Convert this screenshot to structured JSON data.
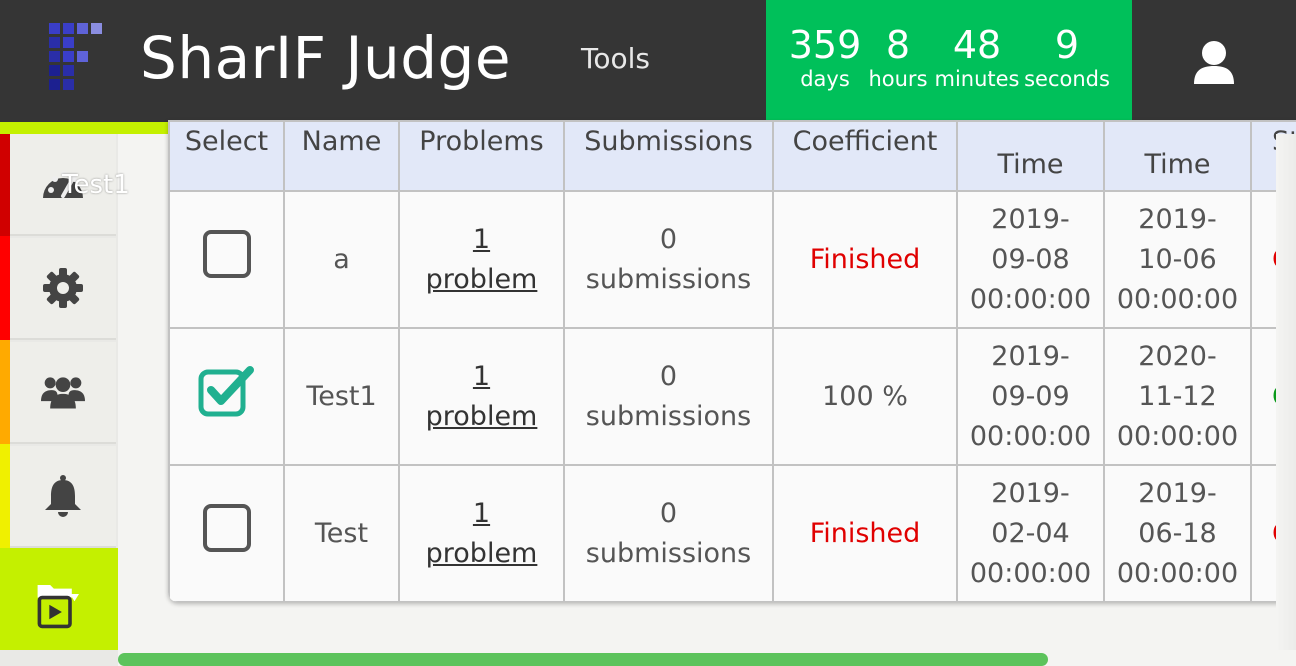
{
  "header": {
    "app_title": "SharIF Judge",
    "nav_tools": "Tools",
    "countdown": [
      {
        "value": "359",
        "unit": "days"
      },
      {
        "value": "8",
        "unit": "hours"
      },
      {
        "value": "48",
        "unit": "minutes"
      },
      {
        "value": "9",
        "unit": "seconds"
      }
    ],
    "countdown_color": "#00c05a",
    "accent_color": "#c4f000"
  },
  "sidebar": {
    "tooltip": "Test1",
    "items": [
      {
        "icon": "dashboard-icon"
      },
      {
        "icon": "gear-icon"
      },
      {
        "icon": "users-icon"
      },
      {
        "icon": "bell-icon"
      },
      {
        "icon": "folder-play-icon"
      }
    ]
  },
  "table": {
    "headers": [
      "Select",
      "Name",
      "Problems",
      "Submissions",
      "Coefficient",
      "Time",
      "Time",
      "Sta"
    ],
    "rows": [
      {
        "selected": false,
        "name": "a",
        "problems_count": "1",
        "problems_word": "problem",
        "subs_count": "0",
        "subs_word": "submissions",
        "coefficient": "Finished",
        "start": [
          "2019-",
          "09-08",
          "00:00:00"
        ],
        "finish": [
          "2019-",
          "10-06",
          "00:00:00"
        ],
        "status": "Cl"
      },
      {
        "selected": true,
        "name": "Test1",
        "problems_count": "1",
        "problems_word": "problem",
        "subs_count": "0",
        "subs_word": "submissions",
        "coefficient": "100 %",
        "start": [
          "2019-",
          "09-09",
          "00:00:00"
        ],
        "finish": [
          "2020-",
          "11-12",
          "00:00:00"
        ],
        "status": "O"
      },
      {
        "selected": false,
        "name": "Test",
        "problems_count": "1",
        "problems_word": "problem",
        "subs_count": "0",
        "subs_word": "submissions",
        "coefficient": "Finished",
        "start": [
          "2019-",
          "02-04",
          "00:00:00"
        ],
        "finish": [
          "2019-",
          "06-18",
          "00:00:00"
        ],
        "status": "Cl"
      }
    ]
  }
}
